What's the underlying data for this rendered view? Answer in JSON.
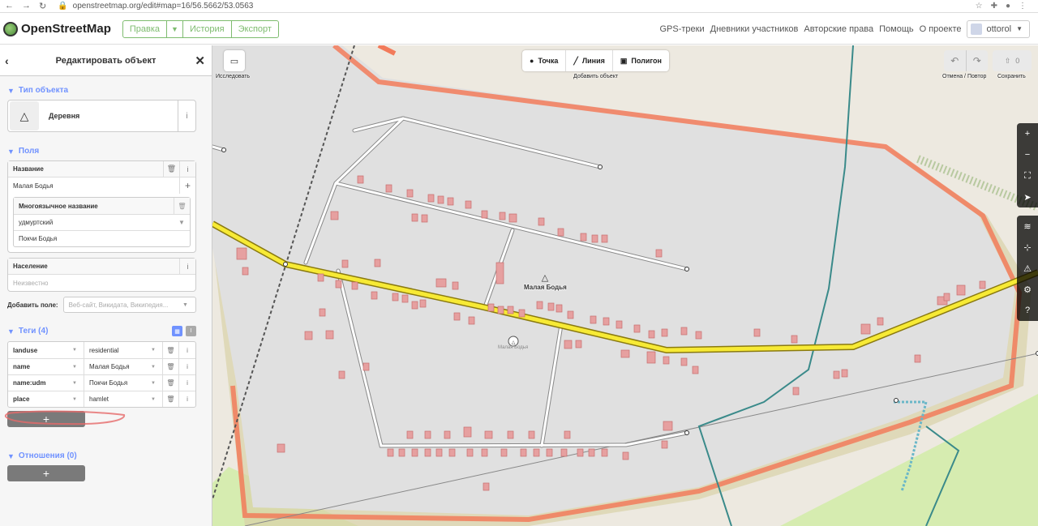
{
  "browser": {
    "url": "openstreetmap.org/edit#map=16/56.5662/53.0563"
  },
  "header": {
    "logo_text": "OpenStreetMap",
    "edit_label": "Правка",
    "history_label": "История",
    "export_label": "Экспорт",
    "links": [
      "GPS-треки",
      "Дневники участников",
      "Авторские права",
      "Помощь",
      "О проекте"
    ],
    "username": "ottorol"
  },
  "sidebar": {
    "title": "Редактировать объект",
    "type_section": "Тип объекта",
    "preset_name": "Деревня",
    "fields_section": "Поля",
    "name_label": "Название",
    "name_value": "Малая Бодья",
    "multilingual_label": "Многоязычное название",
    "language_value": "удмуртский",
    "localized_value": "Покчи Бодья",
    "population_label": "Население",
    "population_placeholder": "Неизвестно",
    "add_field_label": "Добавить поле:",
    "add_field_placeholder": "Веб-сайт, Викидата, Википедия...",
    "tags_section": "Теги (4)",
    "tags": [
      {
        "key": "landuse",
        "value": "residential"
      },
      {
        "key": "name",
        "value": "Малая Бодья"
      },
      {
        "key": "name:udm",
        "value": "Покчи Бодья"
      },
      {
        "key": "place",
        "value": "hamlet"
      }
    ],
    "relations_section": "Отношения (0)",
    "add_symbol": "+"
  },
  "map": {
    "inspect_label": "Исследовать",
    "point_label": "Точка",
    "line_label": "Линия",
    "area_label": "Полигон",
    "add_feature_caption": "Добавить объект",
    "undo_redo_caption": "Отмена / Повтор",
    "save_caption": "Сохранить",
    "save_count": "0",
    "village_label": "Малая Бодья",
    "village_small_label": "Малая Бодья"
  },
  "colors": {
    "osm_green": "#7ebc6f",
    "ideditor_blue": "#7092ff",
    "residential_fill": "#e0e0e0",
    "primary_road": "#f7ea35",
    "boundary_orange": "#f27b5b",
    "building": "#e6a0a0"
  },
  "icons": [
    "back-icon",
    "close-icon",
    "triangle-village-icon",
    "info-icon",
    "trash-icon",
    "plus-icon",
    "point-icon",
    "line-icon",
    "area-icon",
    "undo-icon",
    "redo-icon",
    "upload-icon",
    "zoom-in-icon",
    "zoom-out-icon",
    "locate-icon",
    "layers-icon",
    "issues-icon",
    "help-icon"
  ]
}
